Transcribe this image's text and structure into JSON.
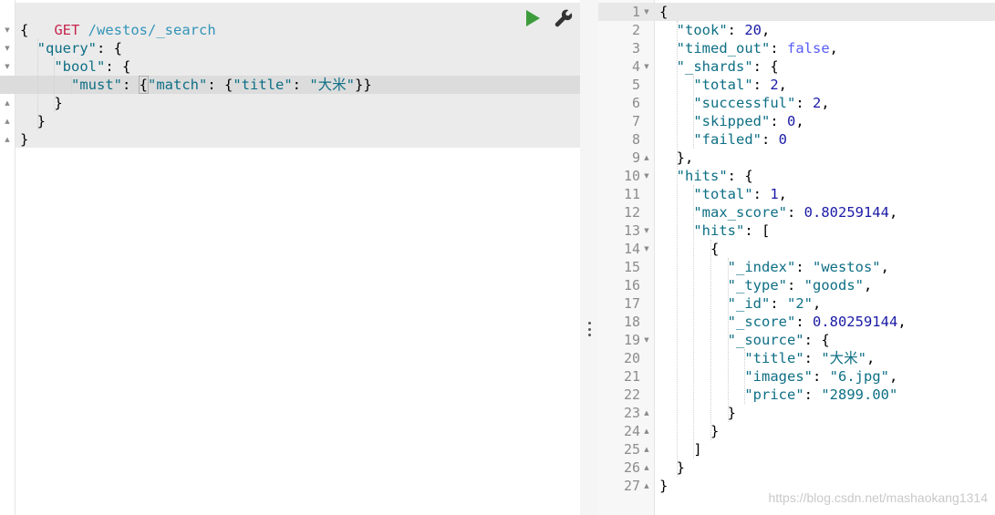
{
  "request": {
    "method": "GET",
    "path": "/westos/_search",
    "lines": [
      [
        {
          "t": "{",
          "c": ""
        }
      ],
      [
        {
          "t": "  ",
          "c": ""
        },
        {
          "t": "\"query\"",
          "c": "key"
        },
        {
          "t": ": {",
          "c": ""
        }
      ],
      [
        {
          "t": "    ",
          "c": ""
        },
        {
          "t": "\"bool\"",
          "c": "key"
        },
        {
          "t": ": {",
          "c": ""
        }
      ],
      [
        {
          "t": "      ",
          "c": ""
        },
        {
          "t": "\"must\"",
          "c": "key"
        },
        {
          "t": ": ",
          "c": ""
        },
        {
          "t": "{",
          "c": "cursor-bracket"
        },
        {
          "t": "\"match\"",
          "c": "key"
        },
        {
          "t": ": {",
          "c": ""
        },
        {
          "t": "\"title\"",
          "c": "key"
        },
        {
          "t": ": ",
          "c": ""
        },
        {
          "t": "\"大米\"",
          "c": "str"
        },
        {
          "t": "}}",
          "c": ""
        }
      ],
      [
        {
          "t": "    }",
          "c": ""
        }
      ],
      [
        {
          "t": "  }",
          "c": ""
        }
      ],
      [
        {
          "t": "}",
          "c": ""
        }
      ]
    ],
    "folds": [
      "down",
      "down",
      "down",
      "",
      "up",
      "up",
      "up"
    ],
    "actions": {
      "send_icon": "play-icon",
      "settings_icon": "wrench-icon",
      "send_color": "#3c9c3c",
      "wrench_color": "#333333"
    }
  },
  "response": {
    "line_numbers": [
      "1",
      "2",
      "3",
      "4",
      "5",
      "6",
      "7",
      "8",
      "9",
      "10",
      "11",
      "12",
      "13",
      "14",
      "15",
      "16",
      "17",
      "18",
      "19",
      "20",
      "21",
      "22",
      "23",
      "24",
      "25",
      "26",
      "27"
    ],
    "folds": [
      "down",
      "",
      "",
      "down",
      "",
      "",
      "",
      "",
      "up",
      "down",
      "",
      "",
      "down",
      "down",
      "",
      "",
      "",
      "",
      "down",
      "",
      "",
      "",
      "up",
      "up",
      "up",
      "up",
      "up"
    ],
    "lines": [
      [
        {
          "t": "{",
          "c": ""
        }
      ],
      [
        {
          "t": "  ",
          "c": ""
        },
        {
          "t": "\"took\"",
          "c": "key"
        },
        {
          "t": ": ",
          "c": ""
        },
        {
          "t": "20",
          "c": "num"
        },
        {
          "t": ",",
          "c": ""
        }
      ],
      [
        {
          "t": "  ",
          "c": ""
        },
        {
          "t": "\"timed_out\"",
          "c": "key"
        },
        {
          "t": ": ",
          "c": ""
        },
        {
          "t": "false",
          "c": "bool"
        },
        {
          "t": ",",
          "c": ""
        }
      ],
      [
        {
          "t": "  ",
          "c": ""
        },
        {
          "t": "\"_shards\"",
          "c": "key"
        },
        {
          "t": ": {",
          "c": ""
        }
      ],
      [
        {
          "t": "    ",
          "c": ""
        },
        {
          "t": "\"total\"",
          "c": "key"
        },
        {
          "t": ": ",
          "c": ""
        },
        {
          "t": "2",
          "c": "num"
        },
        {
          "t": ",",
          "c": ""
        }
      ],
      [
        {
          "t": "    ",
          "c": ""
        },
        {
          "t": "\"successful\"",
          "c": "key"
        },
        {
          "t": ": ",
          "c": ""
        },
        {
          "t": "2",
          "c": "num"
        },
        {
          "t": ",",
          "c": ""
        }
      ],
      [
        {
          "t": "    ",
          "c": ""
        },
        {
          "t": "\"skipped\"",
          "c": "key"
        },
        {
          "t": ": ",
          "c": ""
        },
        {
          "t": "0",
          "c": "num"
        },
        {
          "t": ",",
          "c": ""
        }
      ],
      [
        {
          "t": "    ",
          "c": ""
        },
        {
          "t": "\"failed\"",
          "c": "key"
        },
        {
          "t": ": ",
          "c": ""
        },
        {
          "t": "0",
          "c": "num"
        }
      ],
      [
        {
          "t": "  },",
          "c": ""
        }
      ],
      [
        {
          "t": "  ",
          "c": ""
        },
        {
          "t": "\"hits\"",
          "c": "key"
        },
        {
          "t": ": {",
          "c": ""
        }
      ],
      [
        {
          "t": "    ",
          "c": ""
        },
        {
          "t": "\"total\"",
          "c": "key"
        },
        {
          "t": ": ",
          "c": ""
        },
        {
          "t": "1",
          "c": "num"
        },
        {
          "t": ",",
          "c": ""
        }
      ],
      [
        {
          "t": "    ",
          "c": ""
        },
        {
          "t": "\"max_score\"",
          "c": "key"
        },
        {
          "t": ": ",
          "c": ""
        },
        {
          "t": "0.80259144",
          "c": "num"
        },
        {
          "t": ",",
          "c": ""
        }
      ],
      [
        {
          "t": "    ",
          "c": ""
        },
        {
          "t": "\"hits\"",
          "c": "key"
        },
        {
          "t": ": [",
          "c": ""
        }
      ],
      [
        {
          "t": "      {",
          "c": ""
        }
      ],
      [
        {
          "t": "        ",
          "c": ""
        },
        {
          "t": "\"_index\"",
          "c": "key"
        },
        {
          "t": ": ",
          "c": ""
        },
        {
          "t": "\"westos\"",
          "c": "str"
        },
        {
          "t": ",",
          "c": ""
        }
      ],
      [
        {
          "t": "        ",
          "c": ""
        },
        {
          "t": "\"_type\"",
          "c": "key"
        },
        {
          "t": ": ",
          "c": ""
        },
        {
          "t": "\"goods\"",
          "c": "str"
        },
        {
          "t": ",",
          "c": ""
        }
      ],
      [
        {
          "t": "        ",
          "c": ""
        },
        {
          "t": "\"_id\"",
          "c": "key"
        },
        {
          "t": ": ",
          "c": ""
        },
        {
          "t": "\"2\"",
          "c": "str"
        },
        {
          "t": ",",
          "c": ""
        }
      ],
      [
        {
          "t": "        ",
          "c": ""
        },
        {
          "t": "\"_score\"",
          "c": "key"
        },
        {
          "t": ": ",
          "c": ""
        },
        {
          "t": "0.80259144",
          "c": "num"
        },
        {
          "t": ",",
          "c": ""
        }
      ],
      [
        {
          "t": "        ",
          "c": ""
        },
        {
          "t": "\"_source\"",
          "c": "key"
        },
        {
          "t": ": {",
          "c": ""
        }
      ],
      [
        {
          "t": "          ",
          "c": ""
        },
        {
          "t": "\"title\"",
          "c": "key"
        },
        {
          "t": ": ",
          "c": ""
        },
        {
          "t": "\"大米\"",
          "c": "str"
        },
        {
          "t": ",",
          "c": ""
        }
      ],
      [
        {
          "t": "          ",
          "c": ""
        },
        {
          "t": "\"images\"",
          "c": "key"
        },
        {
          "t": ": ",
          "c": ""
        },
        {
          "t": "\"6.jpg\"",
          "c": "str"
        },
        {
          "t": ",",
          "c": ""
        }
      ],
      [
        {
          "t": "          ",
          "c": ""
        },
        {
          "t": "\"price\"",
          "c": "key"
        },
        {
          "t": ": ",
          "c": ""
        },
        {
          "t": "\"2899.00\"",
          "c": "str"
        }
      ],
      [
        {
          "t": "        }",
          "c": ""
        }
      ],
      [
        {
          "t": "      }",
          "c": ""
        }
      ],
      [
        {
          "t": "    ]",
          "c": ""
        }
      ],
      [
        {
          "t": "  }",
          "c": ""
        }
      ],
      [
        {
          "t": "}",
          "c": ""
        }
      ]
    ]
  },
  "watermark": "https://blog.csdn.net/mashaokang1314",
  "colors": {
    "method": "#c7254e",
    "url": "#3394b8",
    "key": "#0e6f85",
    "number": "#1a1aa6",
    "boolean": "#585cf6"
  }
}
